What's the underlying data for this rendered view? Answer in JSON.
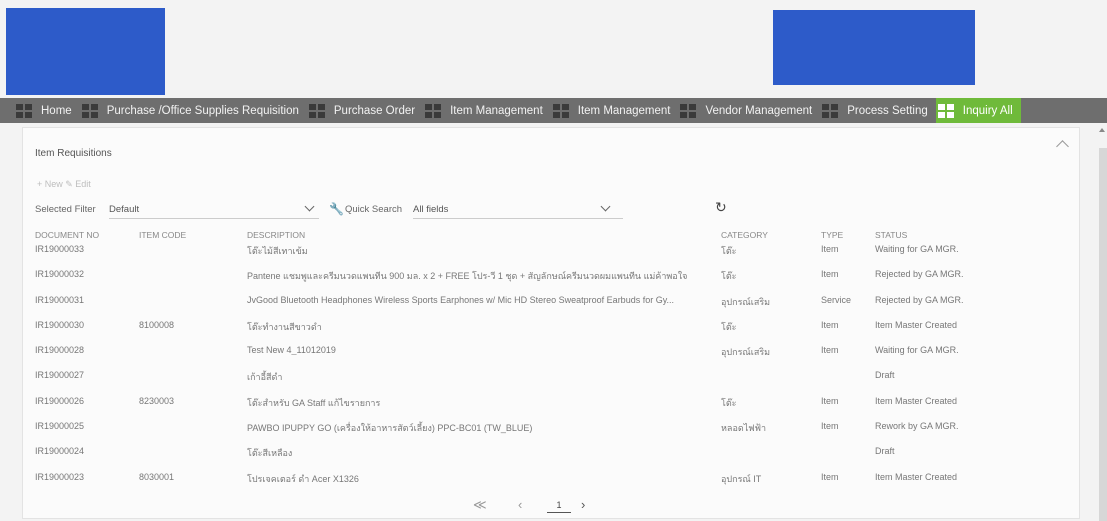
{
  "nav": {
    "items": [
      {
        "label": "Home"
      },
      {
        "label": "Purchase /Office Supplies Requisition"
      },
      {
        "label": "Purchase Order"
      },
      {
        "label": "Item Management"
      },
      {
        "label": "Item Management"
      },
      {
        "label": "Vendor Management"
      },
      {
        "label": "Process Setting"
      },
      {
        "label": "Inquiry All"
      }
    ],
    "active_color": "#6fba3a"
  },
  "panel": {
    "title": "Item Requisitions",
    "toolbar_text": "+ New   ✎ Edit"
  },
  "filter": {
    "label": "Selected Filter",
    "value": "Default",
    "quick_search_label": "Quick Search",
    "quick_search_value": "All fields"
  },
  "grid": {
    "headers": {
      "document_no": "DOCUMENT NO",
      "item_code": "ITEM CODE",
      "description": "DESCRIPTION",
      "category": "CATEGORY",
      "type": "TYPE",
      "status": "STATUS"
    },
    "rows": [
      {
        "document_no": "IR19000033",
        "item_code": "",
        "description": "โต๊ะไม้สีเทาเข้ม",
        "category": "โต๊ะ",
        "type": "Item",
        "status": "Waiting for GA MGR."
      },
      {
        "document_no": "IR19000032",
        "item_code": "",
        "description": "Pantene แชมพูและครีมนวดแพนทีน 900 มล. x 2 + FREE โปร-วี 1 ชุด + สัญลักษณ์ครีมนวดผมแพนทีน แม่ค้าพอใจ",
        "category": "โต๊ะ",
        "type": "Item",
        "status": "Rejected by GA MGR."
      },
      {
        "document_no": "IR19000031",
        "item_code": "",
        "description": "JvGood Bluetooth Headphones Wireless Sports Earphones w/ Mic HD Stereo Sweatproof Earbuds for Gy...",
        "category": "อุปกรณ์เสริม",
        "type": "Service",
        "status": "Rejected by GA MGR."
      },
      {
        "document_no": "IR19000030",
        "item_code": "8100008",
        "description": "โต๊ะทำงานสีขาวดำ",
        "category": "โต๊ะ",
        "type": "Item",
        "status": "Item Master Created"
      },
      {
        "document_no": "IR19000028",
        "item_code": "",
        "description": "Test New 4_11012019",
        "category": "อุปกรณ์เสริม",
        "type": "Item",
        "status": "Waiting for GA MGR."
      },
      {
        "document_no": "IR19000027",
        "item_code": "",
        "description": "เก้าอี้สีดำ",
        "category": "",
        "type": "",
        "status": "Draft"
      },
      {
        "document_no": "IR19000026",
        "item_code": "8230003",
        "description": "โต๊ะสำหรับ GA Staff แก้ไขรายการ",
        "category": "โต๊ะ",
        "type": "Item",
        "status": "Item Master Created"
      },
      {
        "document_no": "IR19000025",
        "item_code": "",
        "description": "PAWBO IPUPPY GO (เครื่องให้อาหารสัตว์เลี้ยง) PPC-BC01 (TW_BLUE)",
        "category": "หลอดไฟฟ้า",
        "type": "Item",
        "status": "Rework by GA MGR."
      },
      {
        "document_no": "IR19000024",
        "item_code": "",
        "description": "โต๊ะสีเหลือง",
        "category": "",
        "type": "",
        "status": "Draft"
      },
      {
        "document_no": "IR19000023",
        "item_code": "8030001",
        "description": "โปรเจคเตอร์ ดำ Acer X1326",
        "category": "อุปกรณ์ IT",
        "type": "Item",
        "status": "Item Master Created"
      }
    ]
  },
  "pager": {
    "first": "≪",
    "prev": "‹",
    "page": "1",
    "next": "›"
  }
}
